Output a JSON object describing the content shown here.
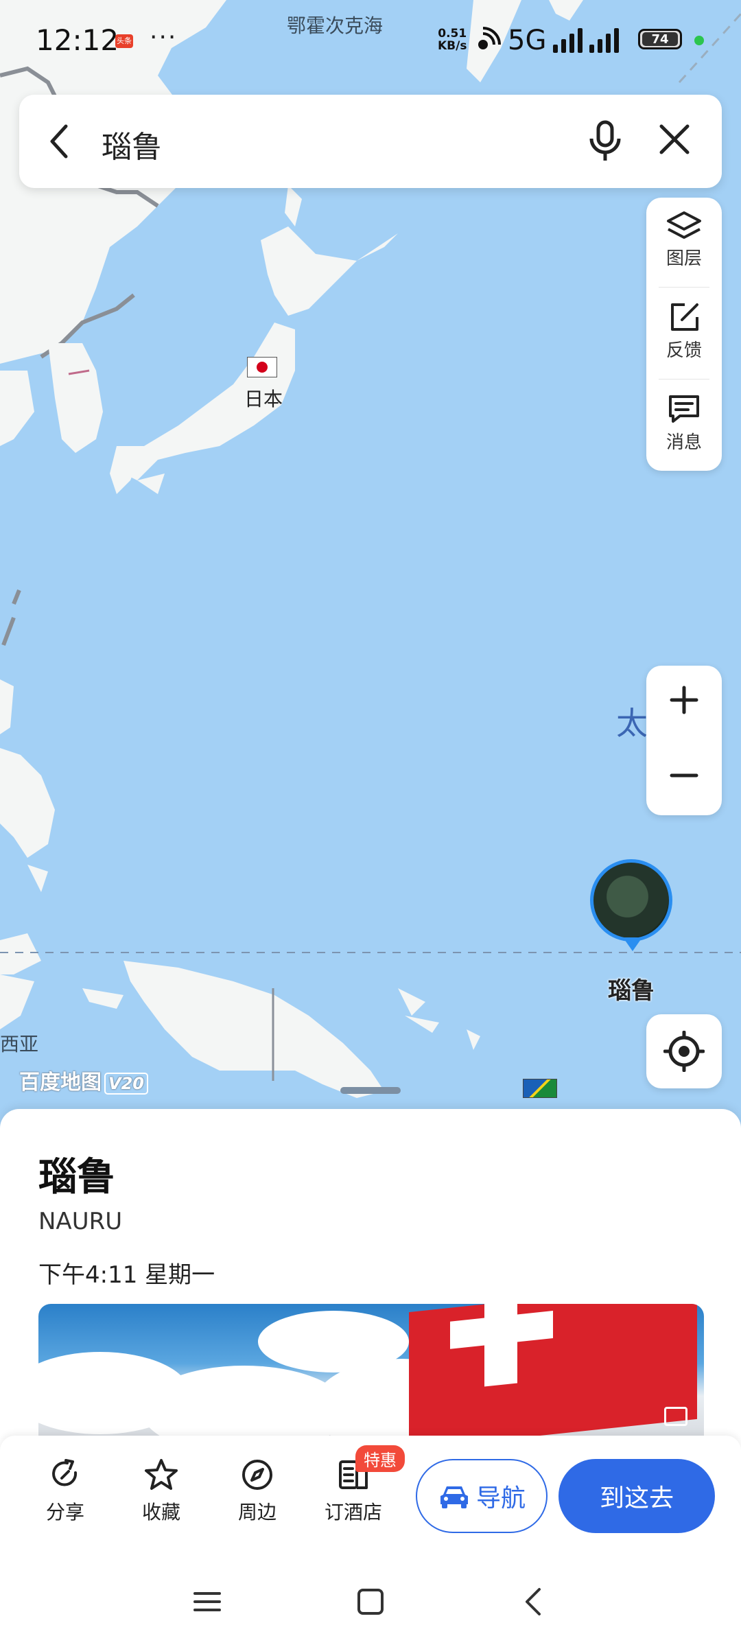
{
  "status_bar": {
    "time": "12:12",
    "news_badge": "头条",
    "more": "···",
    "speed_value": "0.51",
    "speed_unit": "KB/s",
    "network": "5G",
    "battery": "74"
  },
  "map": {
    "top_label": "鄂霍次克海",
    "japan_label": "日本",
    "ocean_label": "太",
    "left_edge_label": "西亚",
    "pin_label": "瑙鲁",
    "logo_text": "百度地图",
    "logo_version": "V20"
  },
  "search": {
    "query": "瑙鲁"
  },
  "tools": [
    {
      "label": "图层",
      "icon": "layers-icon"
    },
    {
      "label": "反馈",
      "icon": "feedback-icon"
    },
    {
      "label": "消息",
      "icon": "message-icon"
    }
  ],
  "place": {
    "title": "瑙鲁",
    "subtitle": "NAURU",
    "local_time": "下午4:11 星期一"
  },
  "actions": {
    "share": "分享",
    "favorite": "收藏",
    "nearby": "周边",
    "hotel": "订酒店",
    "hotel_tag": "特惠",
    "navigate": "导航",
    "go_here": "到这去"
  },
  "colors": {
    "ocean": "#a3d0f5",
    "accent": "#2f6ae6",
    "deal_tag": "#f24a3a"
  }
}
